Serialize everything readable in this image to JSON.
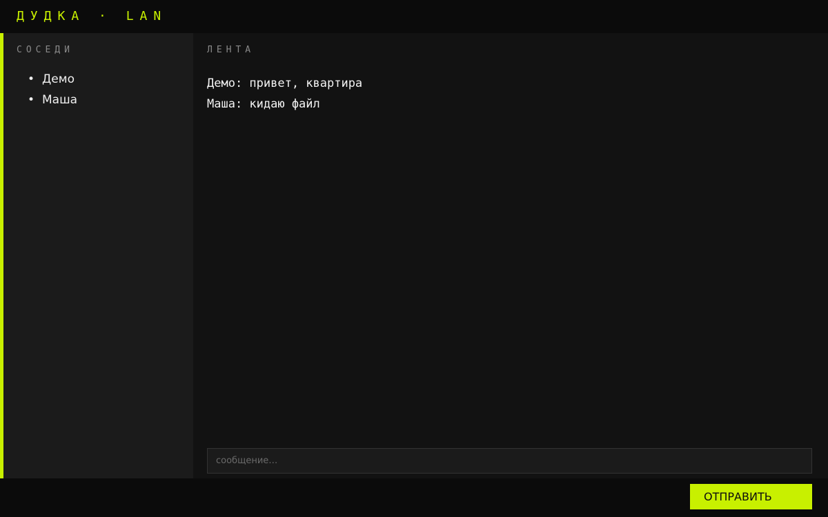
{
  "header": {
    "title": "ДУДКА · LAN"
  },
  "theme": {
    "accent": "#c8f000",
    "background": "#0f0f0f",
    "sidebar_bg": "#1b1b1b",
    "main_bg": "#121212"
  },
  "sidebar": {
    "heading": "СОСЕДИ",
    "peers": [
      {
        "bullet": "•",
        "name": "Демо"
      },
      {
        "bullet": "•",
        "name": "Маша"
      }
    ]
  },
  "feed": {
    "heading": "ЛЕНТА",
    "messages": [
      {
        "text": "Демо: привет, квартира"
      },
      {
        "text": "Маша: кидаю файл"
      }
    ]
  },
  "composer": {
    "placeholder": "сообщение…",
    "value": "",
    "send_label": "ОТПРАВИТЬ"
  }
}
